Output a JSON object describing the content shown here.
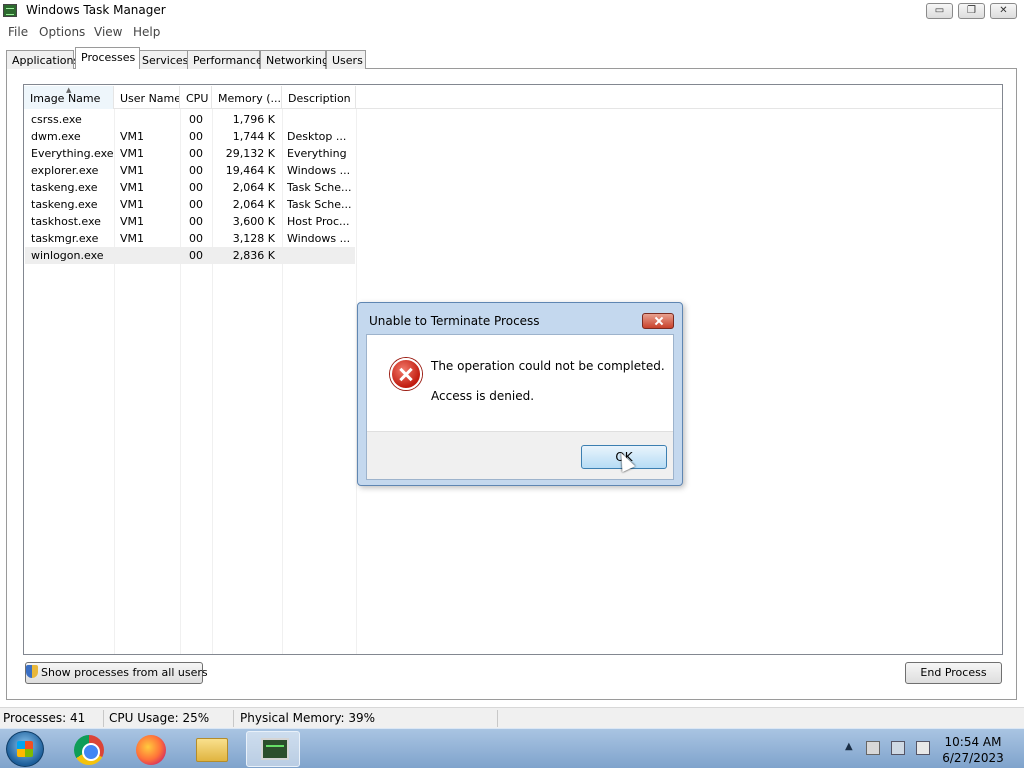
{
  "window": {
    "title": "Windows Task Manager",
    "controls": {
      "minimize": "▭",
      "maximize": "❐",
      "close": "✕"
    }
  },
  "menu": [
    "File",
    "Options",
    "View",
    "Help"
  ],
  "tabs": [
    "Applications",
    "Processes",
    "Services",
    "Performance",
    "Networking",
    "Users"
  ],
  "active_tab": "Processes",
  "process_list": {
    "columns": [
      "Image Name",
      "User Name",
      "CPU",
      "Memory (...",
      "Description"
    ],
    "sorted_column": "Image Name",
    "rows": [
      {
        "image": "csrss.exe",
        "user": "",
        "cpu": "00",
        "memory": "1,796 K",
        "description": ""
      },
      {
        "image": "dwm.exe",
        "user": "VM1",
        "cpu": "00",
        "memory": "1,744 K",
        "description": "Desktop ..."
      },
      {
        "image": "Everything.exe",
        "user": "VM1",
        "cpu": "00",
        "memory": "29,132 K",
        "description": "Everything"
      },
      {
        "image": "explorer.exe",
        "user": "VM1",
        "cpu": "00",
        "memory": "19,464 K",
        "description": "Windows ..."
      },
      {
        "image": "taskeng.exe",
        "user": "VM1",
        "cpu": "00",
        "memory": "2,064 K",
        "description": "Task Sche..."
      },
      {
        "image": "taskeng.exe",
        "user": "VM1",
        "cpu": "00",
        "memory": "2,064 K",
        "description": "Task Sche..."
      },
      {
        "image": "taskhost.exe",
        "user": "VM1",
        "cpu": "00",
        "memory": "3,600 K",
        "description": "Host Proc..."
      },
      {
        "image": "taskmgr.exe",
        "user": "VM1",
        "cpu": "00",
        "memory": "3,128 K",
        "description": "Windows ..."
      },
      {
        "image": "winlogon.exe",
        "user": "",
        "cpu": "00",
        "memory": "2,836 K",
        "description": ""
      }
    ],
    "selected_row": "winlogon.exe"
  },
  "buttons": {
    "show_all": "Show processes from all users",
    "end_process": "End Process"
  },
  "status": {
    "processes": "Processes: 41",
    "cpu": "CPU Usage: 25%",
    "memory": "Physical Memory: 39%"
  },
  "dialog": {
    "title": "Unable to Terminate Process",
    "message": "The operation could not be completed.",
    "detail": "Access is denied.",
    "ok": "OK"
  },
  "taskbar": {
    "apps": [
      "chrome-icon",
      "firefox-icon",
      "folder-icon",
      "task-manager-icon"
    ],
    "active_app": "task-manager-icon",
    "time": "10:54 AM",
    "date": "6/27/2023"
  }
}
